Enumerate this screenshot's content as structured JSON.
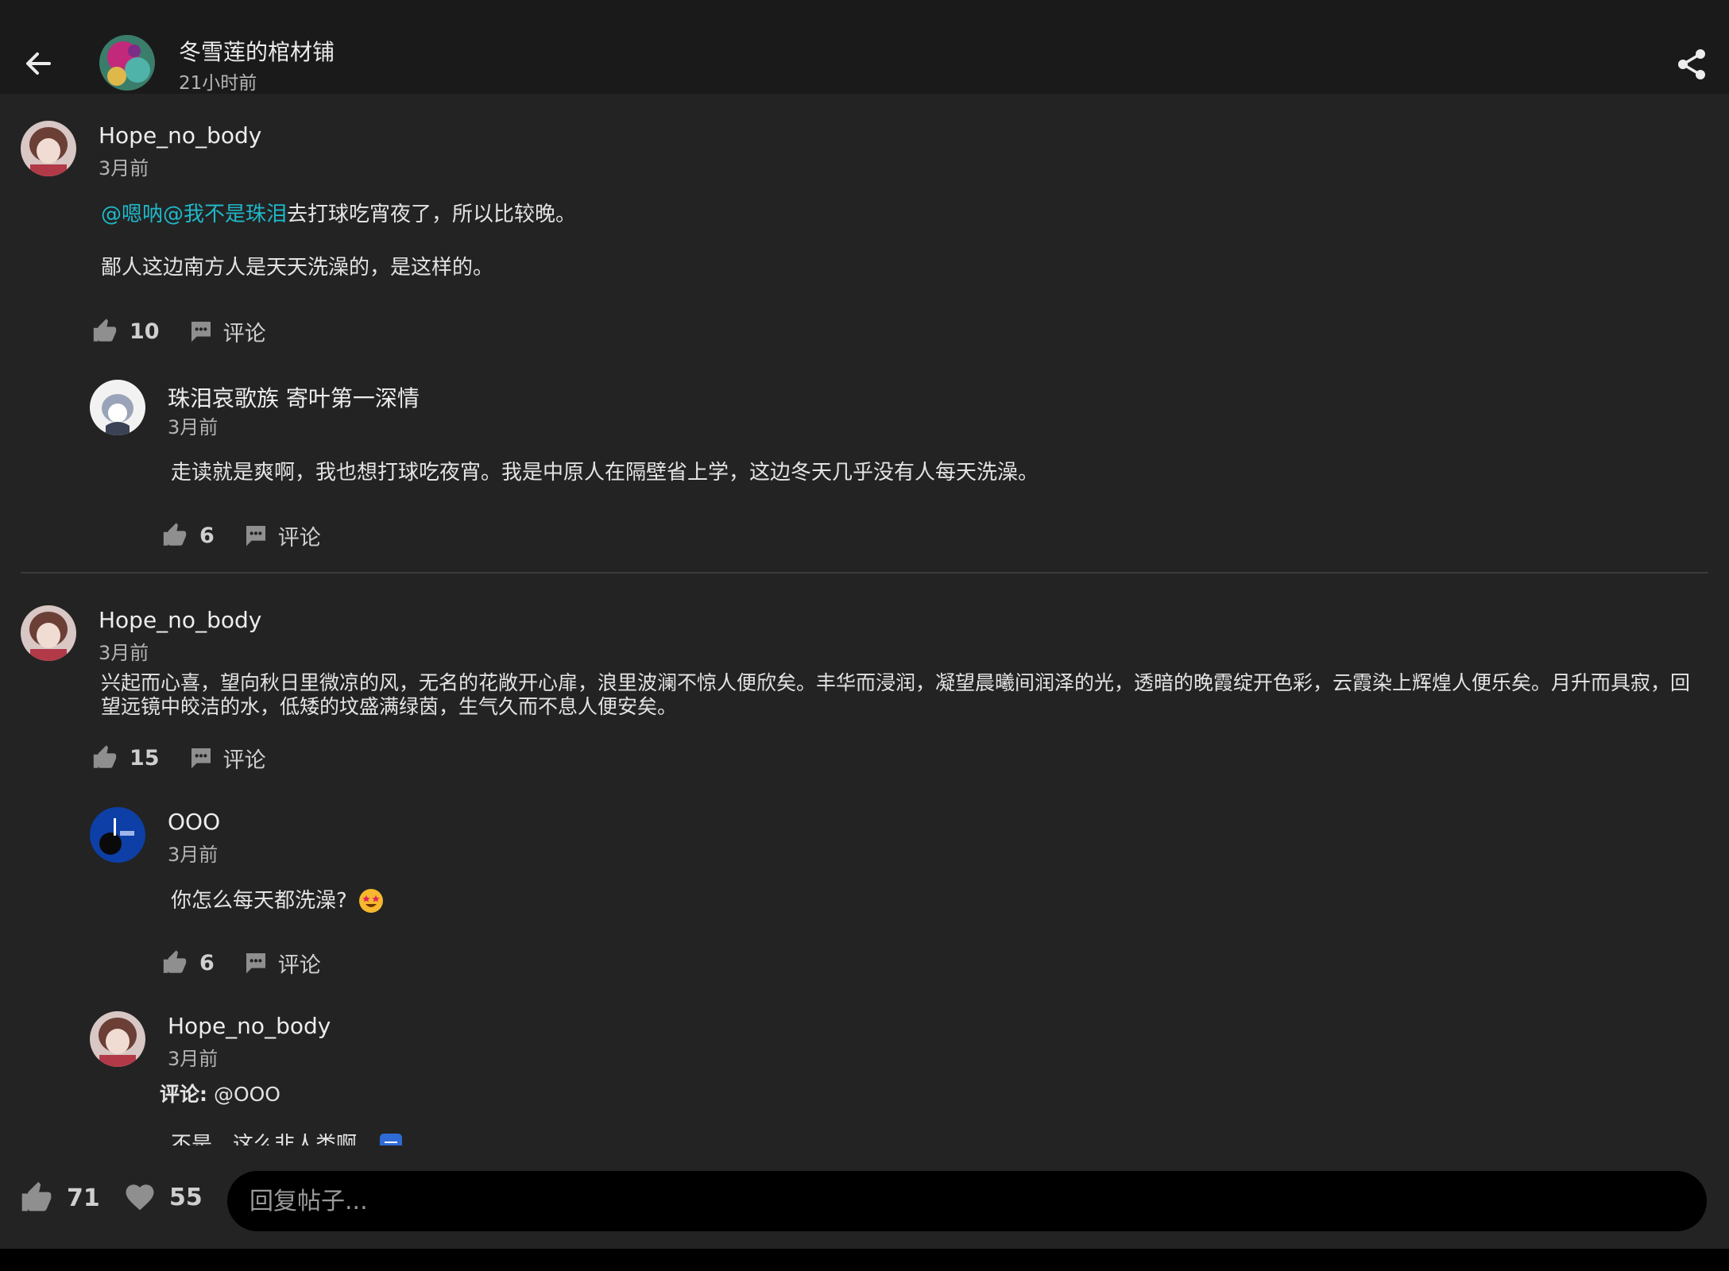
{
  "header": {
    "title": "冬雪莲的棺材铺",
    "time": "21小时前"
  },
  "labels": {
    "comment": "评论"
  },
  "posts": [
    {
      "user": "Hope_no_body",
      "time": "3月前",
      "mention": "@嗯呐@我不是珠泪",
      "line1_rest": "去打球吃宵夜了，所以比较晚。",
      "line2": "鄙人这边南方人是天天洗澡的，是这样的。",
      "likes": "10"
    },
    {
      "user": "珠泪哀歌族 寄叶第一深情",
      "time": "3月前",
      "text": "走读就是爽啊，我也想打球吃夜宵。我是中原人在隔壁省上学，这边冬天几乎没有人每天洗澡。",
      "likes": "6"
    },
    {
      "user": "Hope_no_body",
      "time": "3月前",
      "text": "兴起而心喜，望向秋日里微凉的风，无名的花敞开心扉，浪里波澜不惊人便欣矣。丰华而浸润，凝望晨曦间润泽的光，透暗的晚霞绽开色彩，云霞染上辉煌人便乐矣。月升而具寂，回望远镜中皎洁的水，低矮的坟盛满绿茵，生气久而不息人便安矣。",
      "likes": "15"
    },
    {
      "user": "OOO",
      "time": "3月前",
      "text": "你怎么每天都洗澡?",
      "likes": "6"
    },
    {
      "user": "Hope_no_body",
      "time": "3月前",
      "reply_label": "评论:",
      "reply_to": "@OOO",
      "text": "不是，这么非人类啊"
    }
  ],
  "bottom": {
    "likes": "71",
    "favorites": "55",
    "reply_placeholder": "回复帖子..."
  }
}
